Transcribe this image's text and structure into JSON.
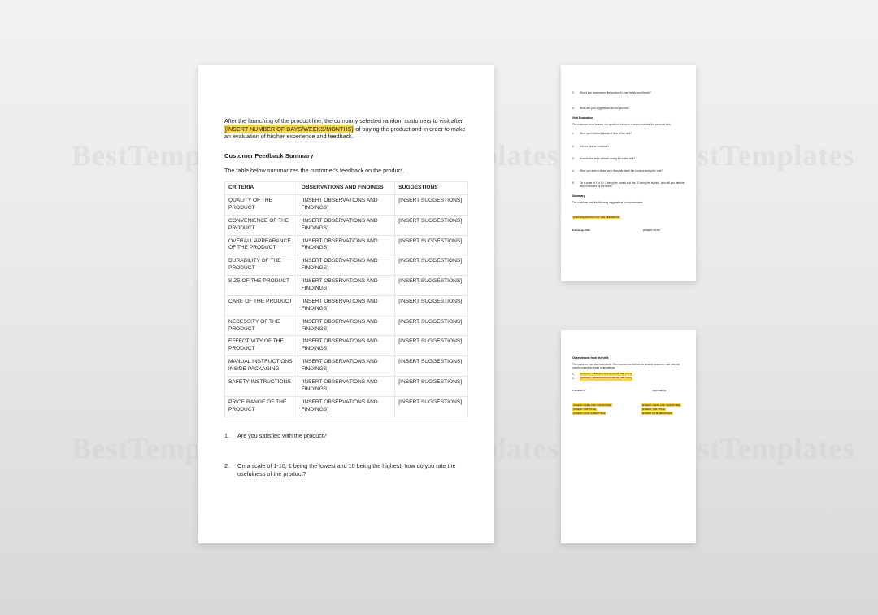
{
  "watermarks": {
    "text": "BestTemplates"
  },
  "main": {
    "intro_a": "After the launching of the product line, the company selected random customers to visit after ",
    "intro_hl": "[INSERT NUMBER OF DAYS/WEEKS/MONTHS]",
    "intro_b": " of buying the product and in order to make an evaluation of his/her experience and feedback.",
    "section_title": "Customer Feedback Summary",
    "table_intro": "The table below summarizes the customer's feedback on the product.",
    "headers": {
      "c1": "CRITERIA",
      "c2": "OBSERVATIONS AND FINDINGS",
      "c3": "SUGGESTIONS"
    },
    "rows": [
      {
        "c1": "QUALITY OF THE PRODUCT",
        "c2": "[INSERT OBSERVATIONS AND FINDINGS]",
        "c3": "[INSERT SUGGESTIONS]"
      },
      {
        "c1": "CONVENIENCE OF THE PRODUCT",
        "c2": "[INSERT OBSERVATIONS AND FINDINGS]",
        "c3": "[INSERT SUGGESTIONS]"
      },
      {
        "c1": "OVERALL APPEARANCE OF THE PRODUCT",
        "c2": "[INSERT OBSERVATIONS AND FINDINGS]",
        "c3": "[INSERT SUGGESTIONS]"
      },
      {
        "c1": "DURABILITY OF THE PRODUCT",
        "c2": "[INSERT OBSERVATIONS AND FINDINGS]",
        "c3": "[INSERT SUGGESTIONS]"
      },
      {
        "c1": "SIZE OF THE PRODUCT",
        "c2": "[INSERT OBSERVATIONS AND FINDINGS]",
        "c3": "[INSERT SUGGESTIONS]"
      },
      {
        "c1": "CARE OF THE PRODUCT",
        "c2": "[INSERT OBSERVATIONS AND FINDINGS]",
        "c3": "[INSERT SUGGESTIONS]"
      },
      {
        "c1": "NECESSITY OF THE PRODUCT",
        "c2": "[INSERT OBSERVATIONS AND FINDINGS]",
        "c3": "[INSERT SUGGESTIONS]"
      },
      {
        "c1": "EFFECTIVITY OF THE PRODUCT",
        "c2": "[INSERT OBSERVATIONS AND FINDINGS]",
        "c3": "[INSERT SUGGESTIONS]"
      },
      {
        "c1": "MANUAL INSTRUCTIONS INSIDE PACKAGING",
        "c2": "[INSERT OBSERVATIONS AND FINDINGS]",
        "c3": "[INSERT SUGGESTIONS]"
      },
      {
        "c1": "SAFETY INSTRUCTIONS",
        "c2": "[INSERT OBSERVATIONS AND FINDINGS]",
        "c3": "[INSERT SUGGESTIONS]"
      },
      {
        "c1": "PRICE RANGE OF THE PRODUCT",
        "c2": "[INSERT OBSERVATIONS AND FINDINGS]",
        "c3": "[INSERT SUGGESTIONS]"
      }
    ],
    "q1_num": "1.",
    "q1": "Are you satisfied with the product?",
    "q2_num": "2.",
    "q2": "On a scale of 1-10, 1 being the lowest and 10 being the highest, how do you rate the usefulness of the product?"
  },
  "p2": {
    "q3_num": "3.",
    "q3": "Would you recommend the product to your family and friends?",
    "q4_num": "4.",
    "q4": "What are your suggestions for the product?",
    "sect": "Visit Evaluation",
    "sub": "The customer must answer the questions below in order to evaluate the personal visit.",
    "e1_num": "1.",
    "e1": "Were you informed ahead of time of the visit?",
    "e2_num": "2.",
    "e2": "Did the visit on schedule?",
    "e3_num": "3.",
    "e3": "How did the team behave during the entire visit?",
    "e4_num": "4.",
    "e4": "Were you able to share your thoughts about the product during the visit?",
    "e5_num": "5.",
    "e5": "On a scale of 1 to 10, 1 being the lowest and the 10 being the highest, how will you rate the visit conducted by the team?",
    "sum_title": "Summary",
    "sum_text": "The customer had the following suggestions for improvement:",
    "sum_hl": "[PROVIDE DETAILS OF THE FEEDBACK]",
    "fu_label": "Follow-up Visit:",
    "fu_val": "[INSERT DATE]"
  },
  "p3": {
    "obs_title": "Observations from the visit:",
    "obs_text": "The customer visit was successful. We recommend that we do another customer visit after six months based on these observations:",
    "b1_num": "1.",
    "b1": "[SPECIFY OBSERVATIONS FROM THE VISIT]",
    "b2_num": "2.",
    "b2": "[SPECIFY OBSERVATIONS FROM THE VISIT]",
    "prepared": "Prepared by:",
    "approved": "Approved by:",
    "sig1_a": "[INSERT NAME AND SIGNATURE]",
    "sig1_b": "[INSERT JOB TITLE]",
    "sig1_c": "[INSERT DATE SUBMITTED]",
    "sig2_a": "[INSERT NAME AND SIGNATURE]",
    "sig2_b": "[INSERT JOB TITLE]",
    "sig2_c": "[INSERT DATE RECEIVED]"
  }
}
